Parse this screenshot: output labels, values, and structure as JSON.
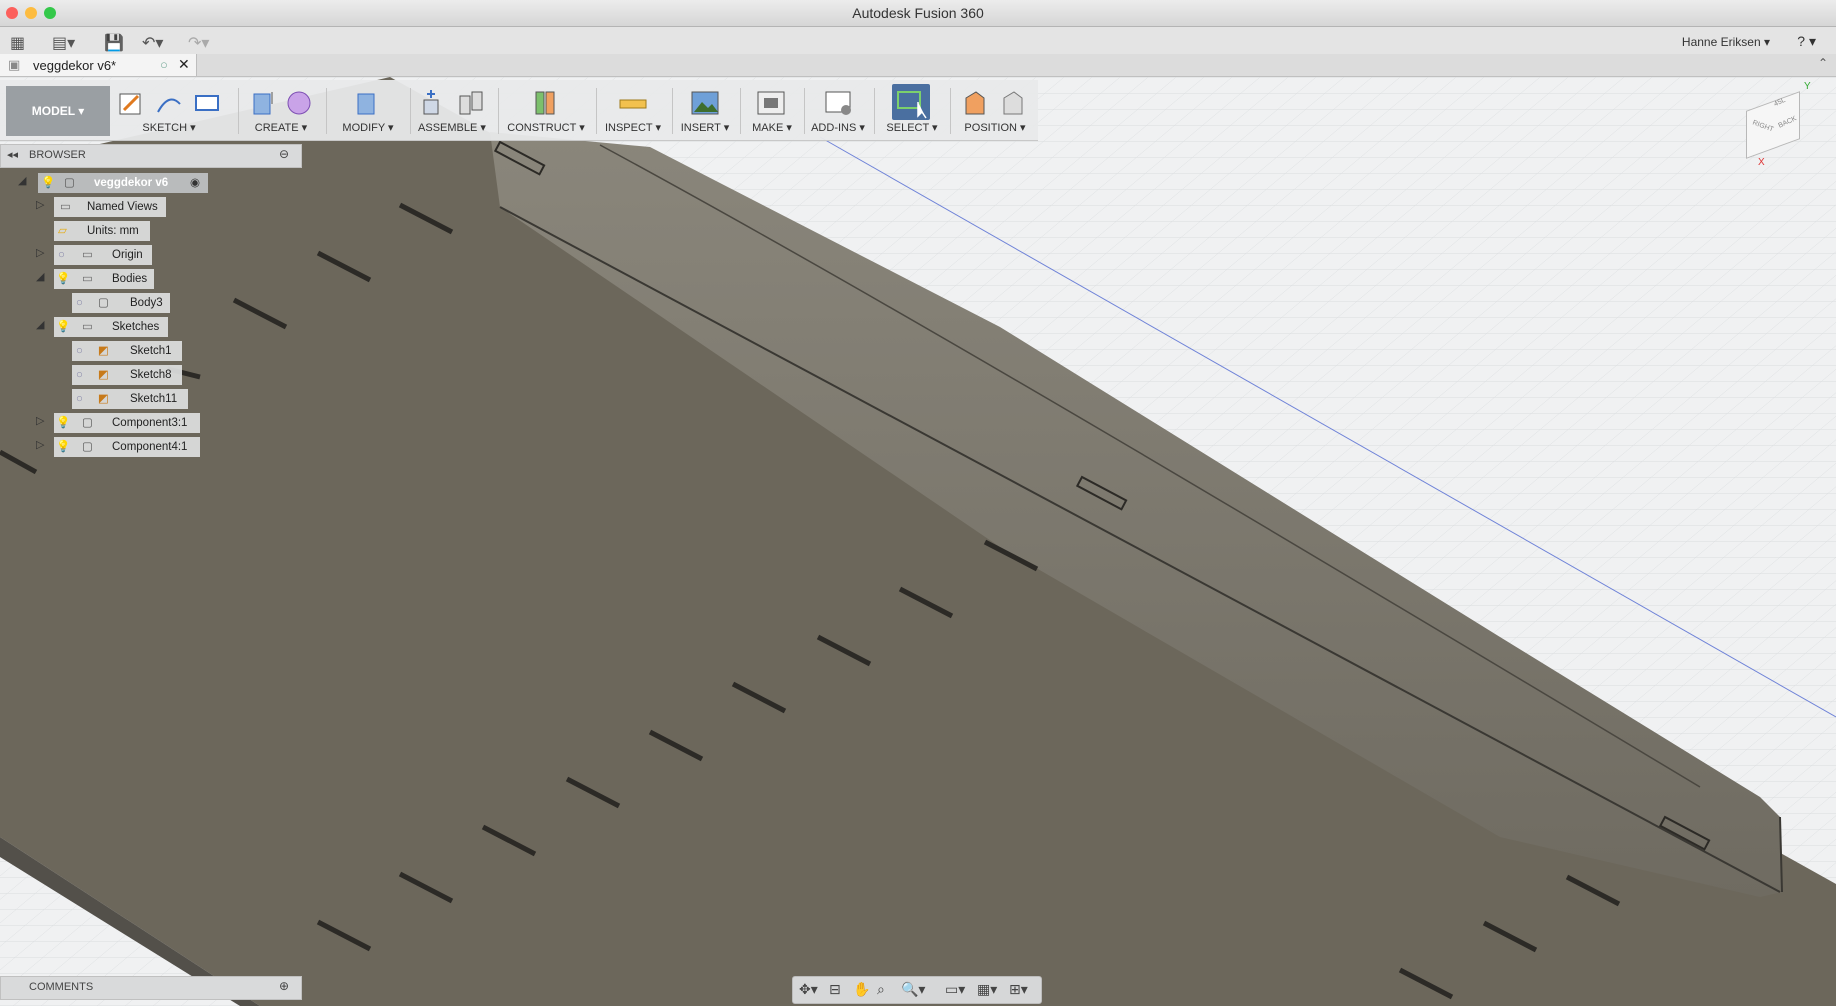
{
  "window": {
    "title": "Autodesk Fusion 360"
  },
  "appbar": {
    "user_name": "Hanne Eriksen",
    "help": "?"
  },
  "tab": {
    "name": "veggdekor v6*"
  },
  "toolbar": {
    "workspace": "MODEL",
    "groups": [
      {
        "label": "SKETCH"
      },
      {
        "label": "CREATE"
      },
      {
        "label": "MODIFY"
      },
      {
        "label": "ASSEMBLE"
      },
      {
        "label": "CONSTRUCT"
      },
      {
        "label": "INSPECT"
      },
      {
        "label": "INSERT"
      },
      {
        "label": "MAKE"
      },
      {
        "label": "ADD-INS"
      },
      {
        "label": "SELECT"
      },
      {
        "label": "POSITION"
      }
    ]
  },
  "browser": {
    "title": "BROWSER",
    "items": [
      {
        "label": "veggdekor v6",
        "icon": "component-icon"
      },
      {
        "label": "Named Views",
        "icon": "folder-icon"
      },
      {
        "label": "Units: mm",
        "icon": "document-icon"
      },
      {
        "label": "Origin",
        "icon": "folder-icon"
      },
      {
        "label": "Bodies",
        "icon": "folder-icon"
      },
      {
        "label": "Body3",
        "icon": "body-icon"
      },
      {
        "label": "Sketches",
        "icon": "folder-icon"
      },
      {
        "label": "Sketch1",
        "icon": "sketch-icon"
      },
      {
        "label": "Sketch8",
        "icon": "sketch-icon"
      },
      {
        "label": "Sketch11",
        "icon": "sketch-icon"
      },
      {
        "label": "Component3:1",
        "icon": "component-icon"
      },
      {
        "label": "Component4:1",
        "icon": "component-icon"
      }
    ]
  },
  "comments": {
    "title": "COMMENTS"
  },
  "viewcube": {
    "faces": [
      "RIGHT",
      "BACK",
      "45L"
    ]
  },
  "axes": {
    "x": "X",
    "y": "Y"
  },
  "colors": {
    "plate": "#6b665a",
    "wall": "#807c71",
    "select_active": "#4a6fa0",
    "grid": "#d9dcde"
  }
}
